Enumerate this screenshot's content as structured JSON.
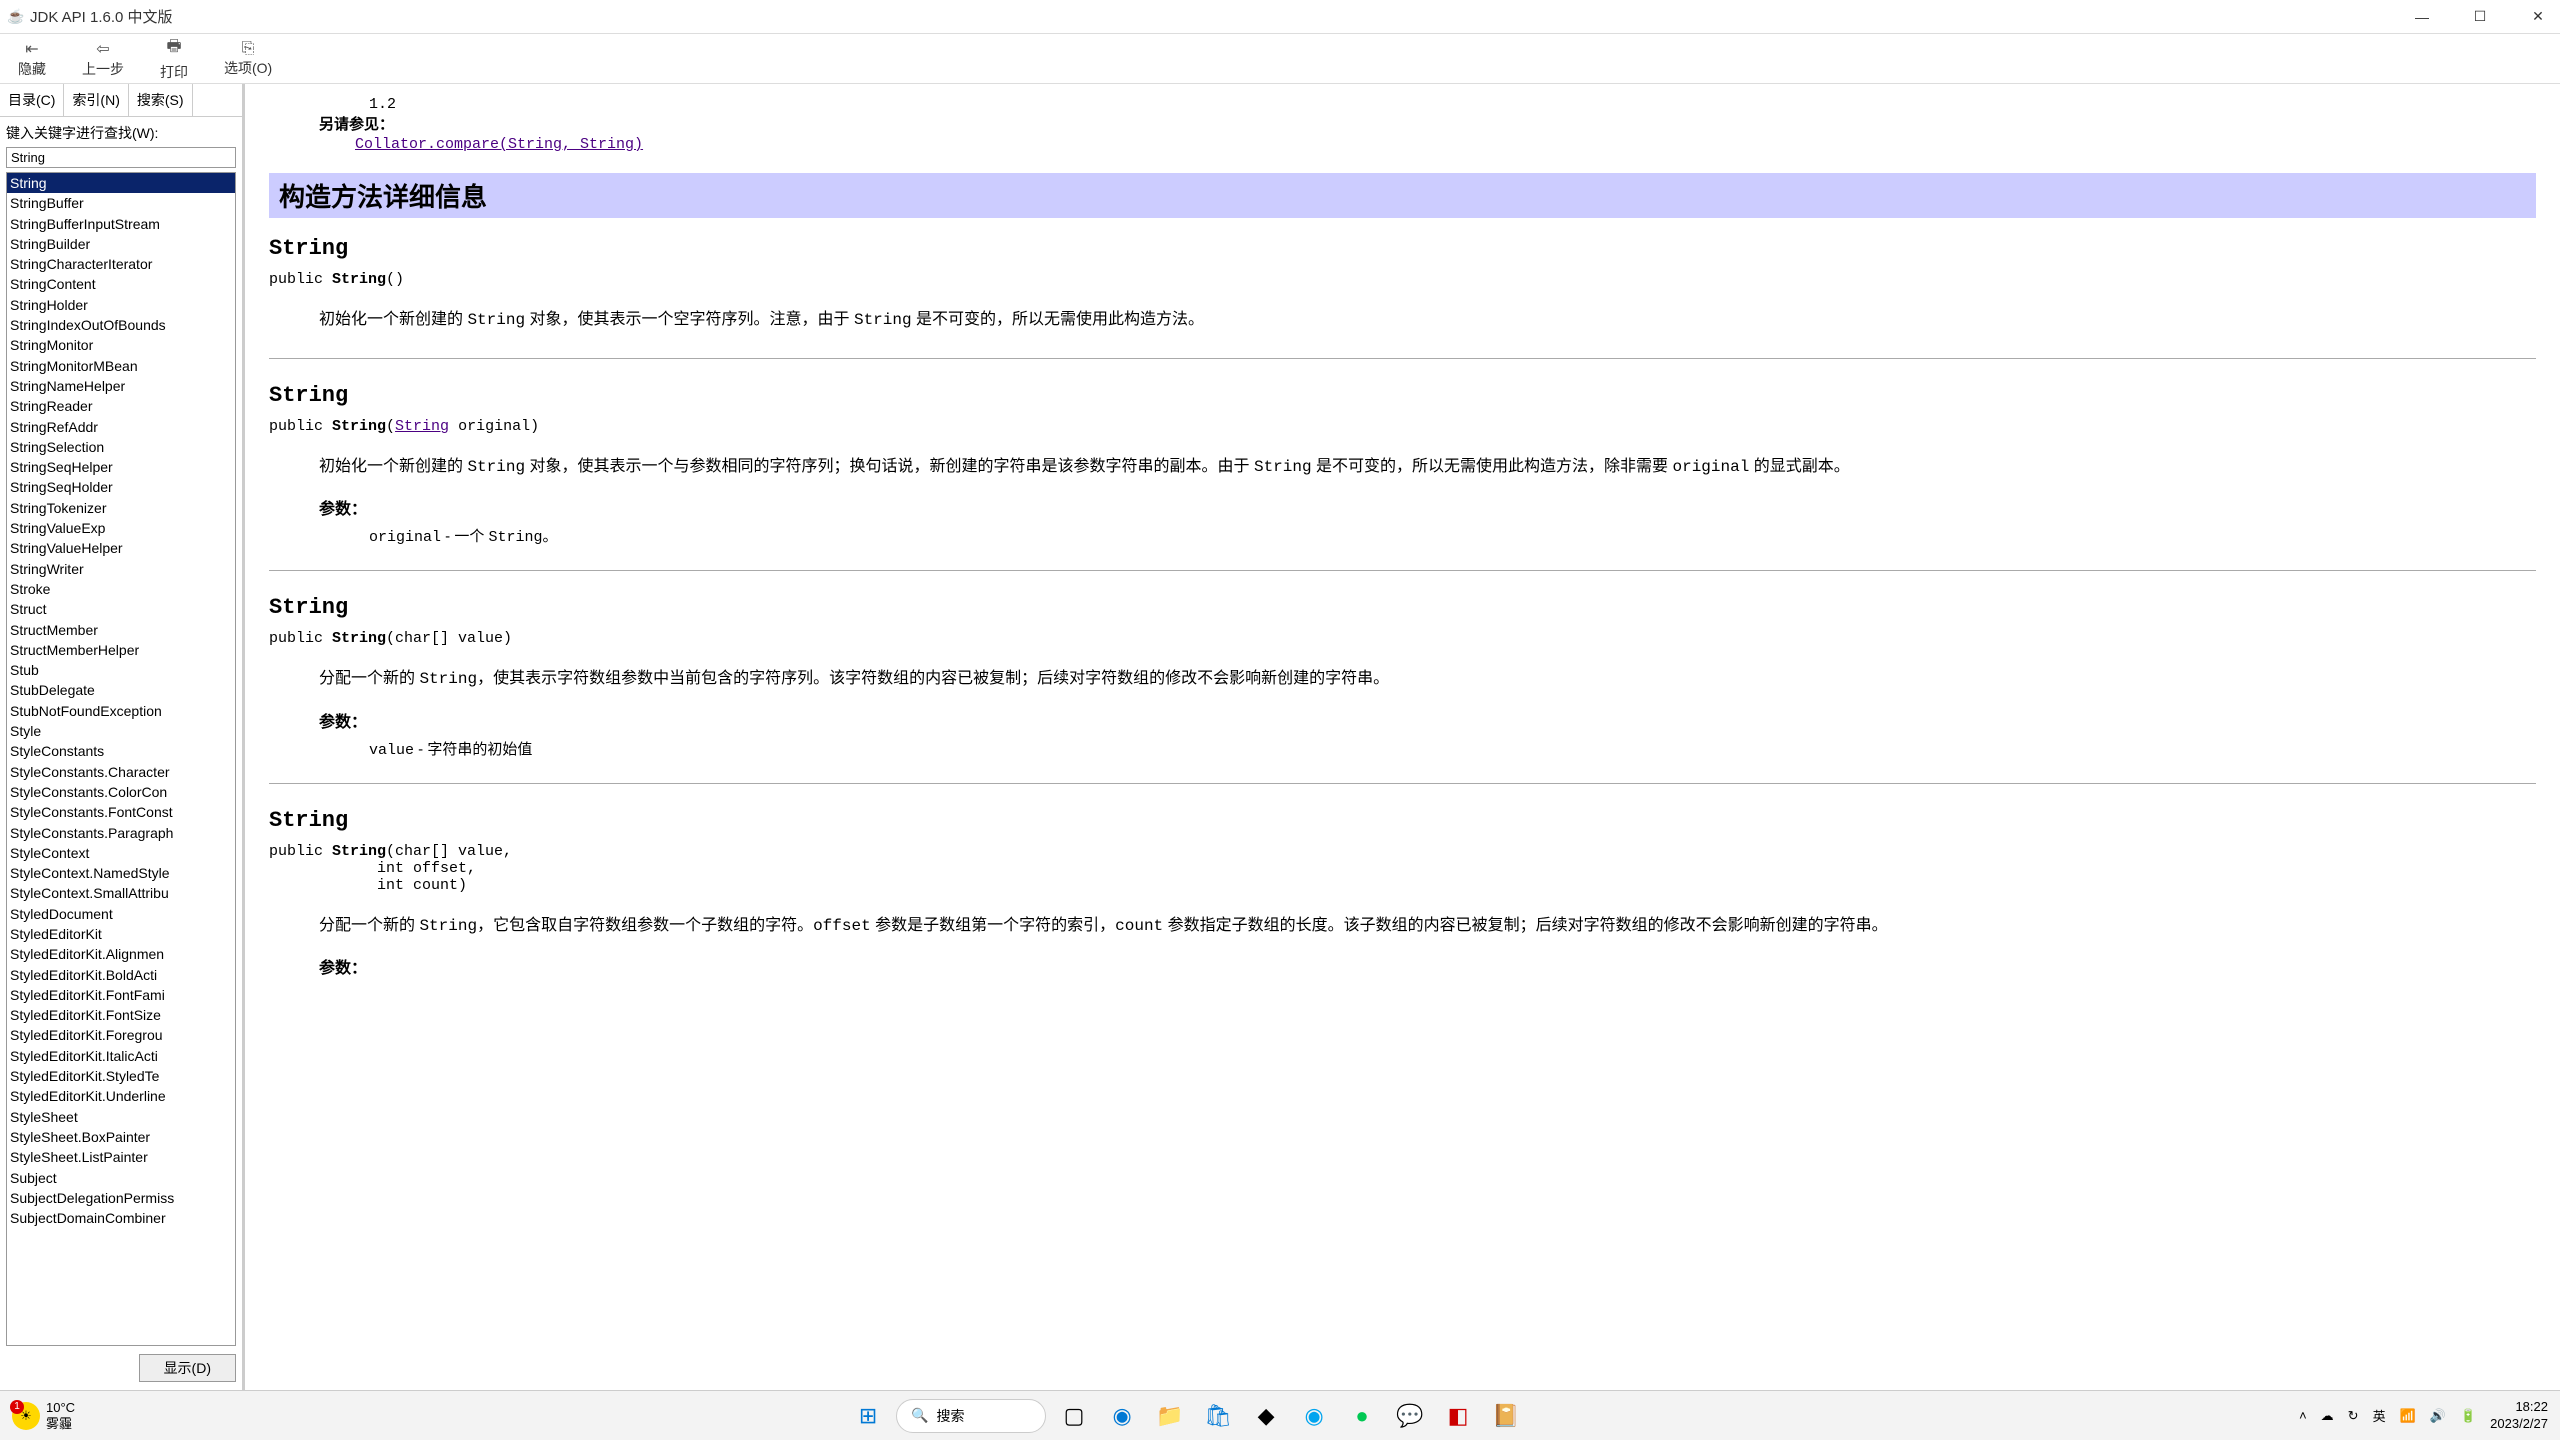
{
  "window": {
    "title": "JDK API 1.6.0 中文版"
  },
  "toolbar": {
    "hide": "隐藏",
    "back": "上一步",
    "print": "打印",
    "options": "选项(O)"
  },
  "sidebar": {
    "tabs": {
      "contents": "目录(C)",
      "index": "索引(N)",
      "search": "搜索(S)"
    },
    "search_label": "键入关键字进行查找(W):",
    "search_value": "String",
    "display_btn": "显示(D)",
    "items": [
      "String",
      "StringBuffer",
      "StringBufferInputStream",
      "StringBuilder",
      "StringCharacterIterator",
      "StringContent",
      "StringHolder",
      "StringIndexOutOfBounds",
      "StringMonitor",
      "StringMonitorMBean",
      "StringNameHelper",
      "StringReader",
      "StringRefAddr",
      "StringSelection",
      "StringSeqHelper",
      "StringSeqHolder",
      "StringTokenizer",
      "StringValueExp",
      "StringValueHelper",
      "StringWriter",
      "Stroke",
      "Struct",
      "StructMember",
      "StructMemberHelper",
      "Stub",
      "StubDelegate",
      "StubNotFoundException",
      "Style",
      "StyleConstants",
      "StyleConstants.Character",
      "StyleConstants.ColorCon",
      "StyleConstants.FontConst",
      "StyleConstants.Paragraph",
      "StyleContext",
      "StyleContext.NamedStyle",
      "StyleContext.SmallAttribu",
      "StyledDocument",
      "StyledEditorKit",
      "StyledEditorKit.Alignmen",
      "StyledEditorKit.BoldActi",
      "StyledEditorKit.FontFami",
      "StyledEditorKit.FontSize",
      "StyledEditorKit.Foregrou",
      "StyledEditorKit.ItalicActi",
      "StyledEditorKit.StyledTe",
      "StyledEditorKit.Underline",
      "StyleSheet",
      "StyleSheet.BoxPainter",
      "StyleSheet.ListPainter",
      "Subject",
      "SubjectDelegationPermiss",
      "SubjectDomainCombiner"
    ]
  },
  "content": {
    "since_version": "1.2",
    "see_also_label": "另请参见：",
    "see_also_link": "Collator.compare(String, String)",
    "section_title": "构造方法详细信息",
    "m1": {
      "name": "String",
      "sig_pre": "public ",
      "sig_kw": "String",
      "sig_post": "()",
      "desc_pre": "初始化一个新创建的 ",
      "desc_code1": "String",
      "desc_mid": " 对象，使其表示一个空字符序列。注意，由于 ",
      "desc_code2": "String",
      "desc_end": " 是不可变的，所以无需使用此构造方法。"
    },
    "m2": {
      "name": "String",
      "sig_pre": "public ",
      "sig_kw": "String",
      "sig_p1": "(",
      "sig_link": "String",
      "sig_p2": " original)",
      "desc": "初始化一个新创建的 ",
      "desc_c1": "String",
      "desc2": " 对象，使其表示一个与参数相同的字符序列；换句话说，新创建的字符串是该参数字符串的副本。由于 ",
      "desc_c2": "String",
      "desc3": " 是不可变的，所以无需使用此构造方法，除非需要 ",
      "desc_c3": "original",
      "desc4": " 的显式副本。",
      "param_head": "参数：",
      "param_name": "original",
      "param_desc": " - 一个 ",
      "param_code": "String",
      "param_end": "。"
    },
    "m3": {
      "name": "String",
      "sig": "public ",
      "sig_kw": "String",
      "sig_post": "(char[] value)",
      "desc": "分配一个新的 ",
      "desc_c1": "String",
      "desc2": "，使其表示字符数组参数中当前包含的字符序列。该字符数组的内容已被复制；后续对字符数组的修改不会影响新创建的字符串。",
      "param_head": "参数：",
      "param_name": "value",
      "param_desc": " - 字符串的初始值"
    },
    "m4": {
      "name": "String",
      "sig": "public ",
      "sig_kw": "String",
      "sig_l1": "(char[] value,",
      "sig_l2": "            int offset,",
      "sig_l3": "            int count)",
      "desc": "分配一个新的 ",
      "desc_c1": "String",
      "desc2": "，它包含取自字符数组参数一个子数组的字符。",
      "desc_c2": "offset",
      "desc3": " 参数是子数组第一个字符的索引，",
      "desc_c3": "count",
      "desc4": " 参数指定子数组的长度。该子数组的内容已被复制；后续对字符数组的修改不会影响新创建的字符串。",
      "param_head": "参数："
    }
  },
  "taskbar": {
    "weather_badge": "1",
    "weather_temp": "10°C",
    "weather_text": "雾霾",
    "search_placeholder": "搜索",
    "ime": "英",
    "time": "18:22",
    "date": "2023/2/27"
  }
}
